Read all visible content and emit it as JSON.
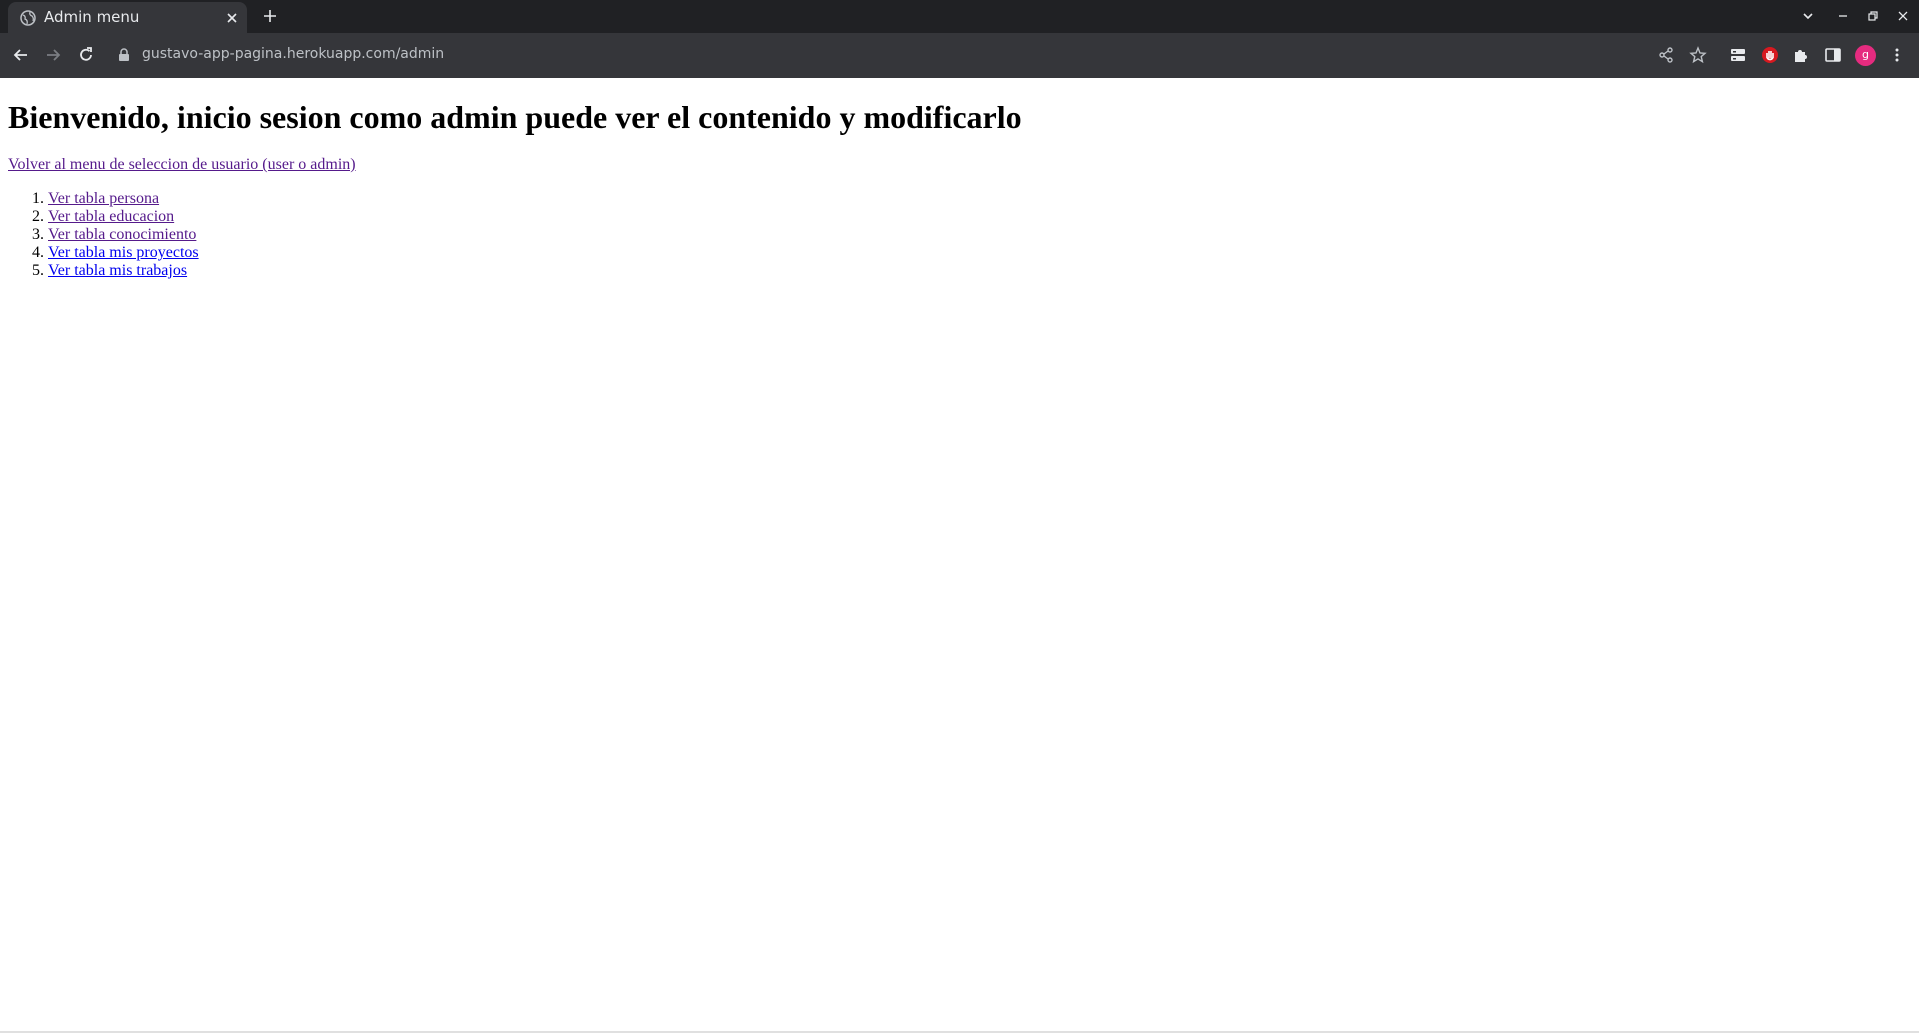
{
  "browser": {
    "tab": {
      "title": "Admin menu"
    },
    "address_bar": {
      "url": "gustavo-app-pagina.herokuapp.com/admin"
    },
    "profile": {
      "initial": "g"
    }
  },
  "page": {
    "heading": "Bienvenido, inicio sesion como admin puede ver el contenido y modificarlo",
    "back_link": "Volver al menu de seleccion de usuario (user o admin)",
    "menu_items": [
      {
        "label": "Ver tabla persona",
        "visited": true
      },
      {
        "label": "Ver tabla educacion",
        "visited": true
      },
      {
        "label": "Ver tabla conocimiento",
        "visited": true
      },
      {
        "label": "Ver tabla mis proyectos",
        "visited": false
      },
      {
        "label": "Ver tabla mis trabajos",
        "visited": false
      }
    ]
  },
  "colors": {
    "tabstrip_bg": "#202124",
    "toolbar_bg": "#35363a",
    "visited_link": "#551a8b",
    "unvisited_link": "#0000ee",
    "avatar": "#e52b7f"
  }
}
